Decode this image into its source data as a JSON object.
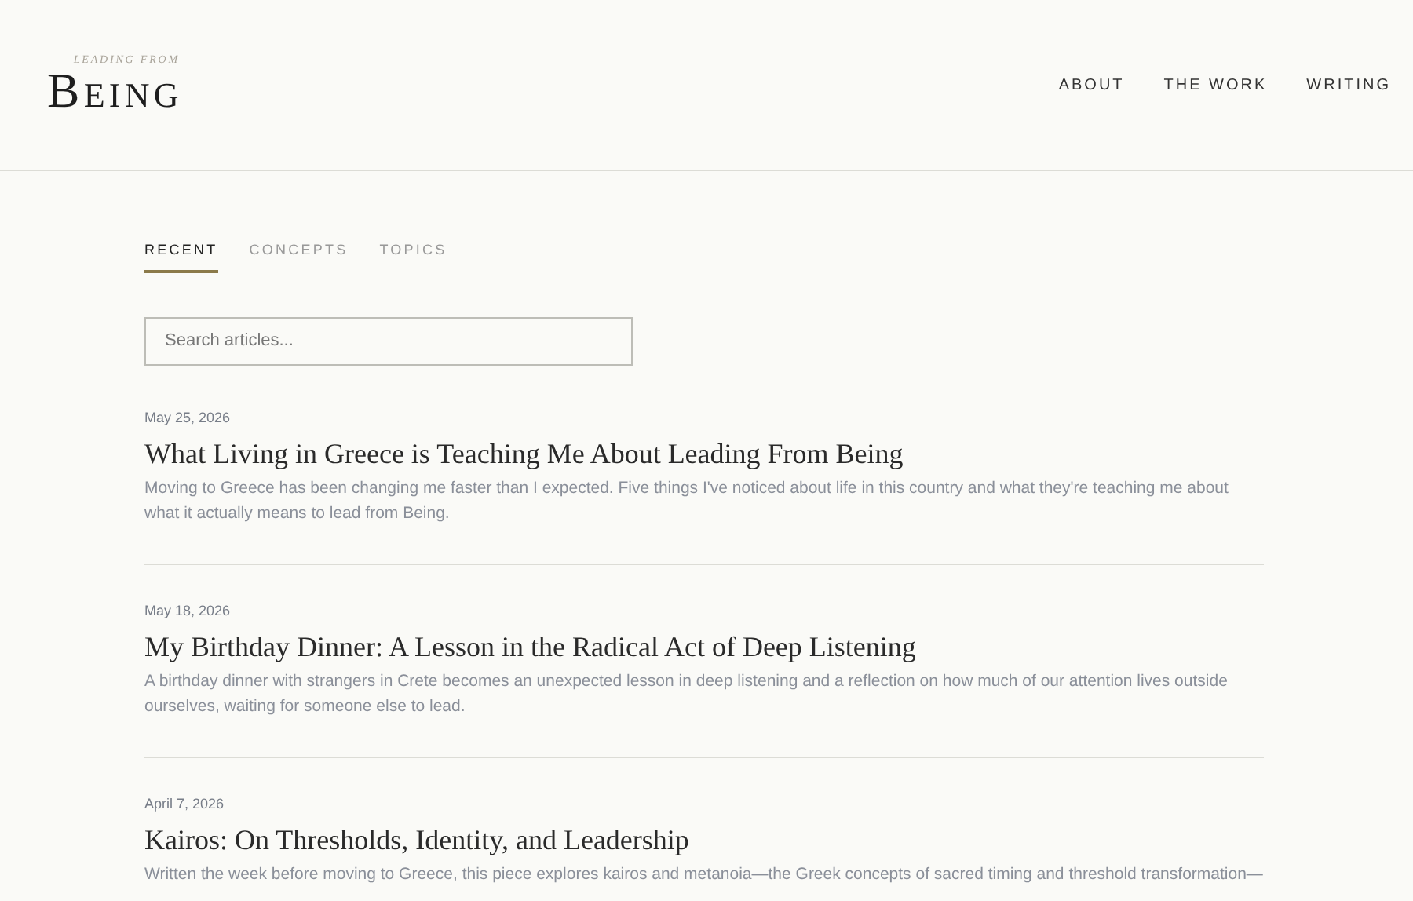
{
  "logo": {
    "tagline": "LEADING FROM",
    "name": "BEING"
  },
  "nav": [
    "ABOUT",
    "THE WORK",
    "WRITING"
  ],
  "tabs": [
    {
      "label": "RECENT",
      "selected": true
    },
    {
      "label": "CONCEPTS",
      "selected": false
    },
    {
      "label": "TOPICS",
      "selected": false
    }
  ],
  "search": {
    "placeholder": "Search articles..."
  },
  "articles": [
    {
      "date": "May 25, 2026",
      "title": "What Living in Greece is Teaching Me About Leading From Being",
      "excerpt": "Moving to Greece has been changing me faster than I expected. Five things I've noticed about life in this country and what they're teaching me about what it actually means to lead from Being."
    },
    {
      "date": "May 18, 2026",
      "title": "My Birthday Dinner: A Lesson in the Radical Act of Deep Listening",
      "excerpt": "A birthday dinner with strangers in Crete becomes an unexpected lesson in deep listening and a reflection on how much of our attention lives outside ourselves, waiting for someone else to lead."
    },
    {
      "date": "April 7, 2026",
      "title": "Kairos: On Thresholds, Identity, and Leadership",
      "excerpt": "Written the week before moving to Greece, this piece explores kairos and metanoia—the Greek concepts of sacred timing and threshold transformation—"
    }
  ]
}
